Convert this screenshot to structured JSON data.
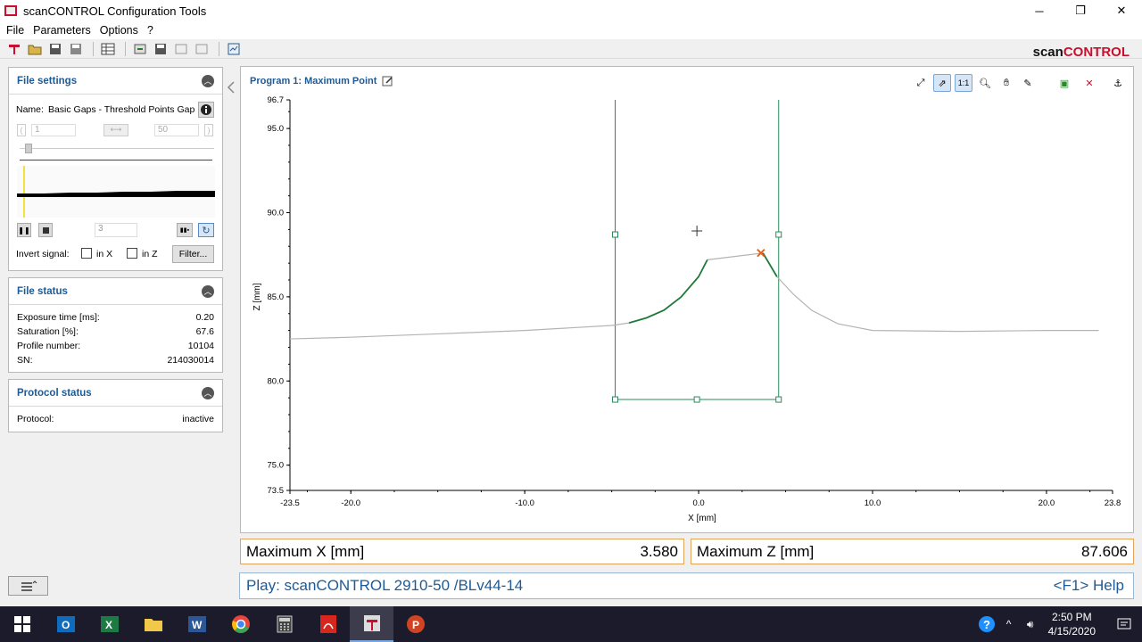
{
  "window": {
    "title": "scanCONTROL Configuration Tools",
    "minimize": "─",
    "maximize": "❐",
    "close": "✕"
  },
  "menu": [
    "File",
    "Parameters",
    "Options",
    "?"
  ],
  "brand": {
    "prefix": "scan",
    "suffix": "CONTROL"
  },
  "file_settings": {
    "title": "File settings",
    "name_label": "Name:",
    "name_value": "Basic Gaps - Threshold Points Gap.a",
    "range_start": "1",
    "range_end": "50",
    "step_value": "3",
    "invert_label": "Invert signal:",
    "in_x_label": "in X",
    "in_z_label": "in Z",
    "filter_label": "Filter..."
  },
  "file_status": {
    "title": "File status",
    "rows": [
      {
        "label": "Exposure time [ms]:",
        "value": "0.20"
      },
      {
        "label": "Saturation [%]:",
        "value": "67.6"
      },
      {
        "label": "Profile number:",
        "value": "10104"
      },
      {
        "label": "SN:",
        "value": "214030014"
      }
    ]
  },
  "protocol_status": {
    "title": "Protocol status",
    "label": "Protocol:",
    "value": "inactive"
  },
  "plot": {
    "title": "Program 1: Maximum Point",
    "xlabel": "X [mm]",
    "ylabel": "Z [mm]",
    "x_ticks": [
      "-23.5",
      "-20.0",
      "-10.0",
      "0.0",
      "10.0",
      "20.0",
      "23.8"
    ],
    "y_ticks": [
      "96.7",
      "95.0",
      "90.0",
      "85.0",
      "80.0",
      "75.0",
      "73.5"
    ],
    "tools": [
      "fit-icon",
      "auto-scale-icon",
      "one-to-one-icon",
      "zoom-icon",
      "pan-icon",
      "picker-icon",
      "add-roi-icon",
      "delete-roi-icon",
      "anchor-icon"
    ]
  },
  "results": {
    "max_x_label": "Maximum X [mm]",
    "max_x_value": "3.580",
    "max_z_label": "Maximum Z [mm]",
    "max_z_value": "87.606"
  },
  "status": {
    "play": "Play: scanCONTROL 2910-50 /BLv44-14",
    "help": "<F1> Help"
  },
  "taskbar": {
    "apps": [
      "start-icon",
      "outlook-icon",
      "excel-icon",
      "explorer-icon",
      "word-icon",
      "chrome-icon",
      "calculator-icon",
      "acrobat-icon",
      "scancontrol-icon",
      "powerpoint-icon"
    ],
    "time": "2:50 PM",
    "date": "4/15/2020"
  },
  "chart_data": {
    "type": "line",
    "title": "Program 1: Maximum Point",
    "xlabel": "X [mm]",
    "ylabel": "Z [mm]",
    "xlim": [
      -23.5,
      23.8
    ],
    "ylim": [
      73.5,
      96.7
    ],
    "series": [
      {
        "x": [
          -23.5,
          -20,
          -15,
          -10,
          -5,
          -4,
          -3,
          -2,
          -1,
          0,
          0.5,
          3.7,
          4.5,
          5.5,
          6.5,
          8,
          10,
          15,
          20,
          23.0
        ],
        "y": [
          82.5,
          82.6,
          82.8,
          83.0,
          83.3,
          83.45,
          83.75,
          84.2,
          85.0,
          86.2,
          87.2,
          87.6,
          86.2,
          85.1,
          84.2,
          83.4,
          83.0,
          82.95,
          83.0,
          83.0
        ]
      }
    ],
    "roi": {
      "x": [
        -4.8,
        4.6
      ],
      "z": [
        78.9,
        88.7
      ]
    },
    "maximum_point": {
      "x": 3.58,
      "z": 87.606
    }
  }
}
